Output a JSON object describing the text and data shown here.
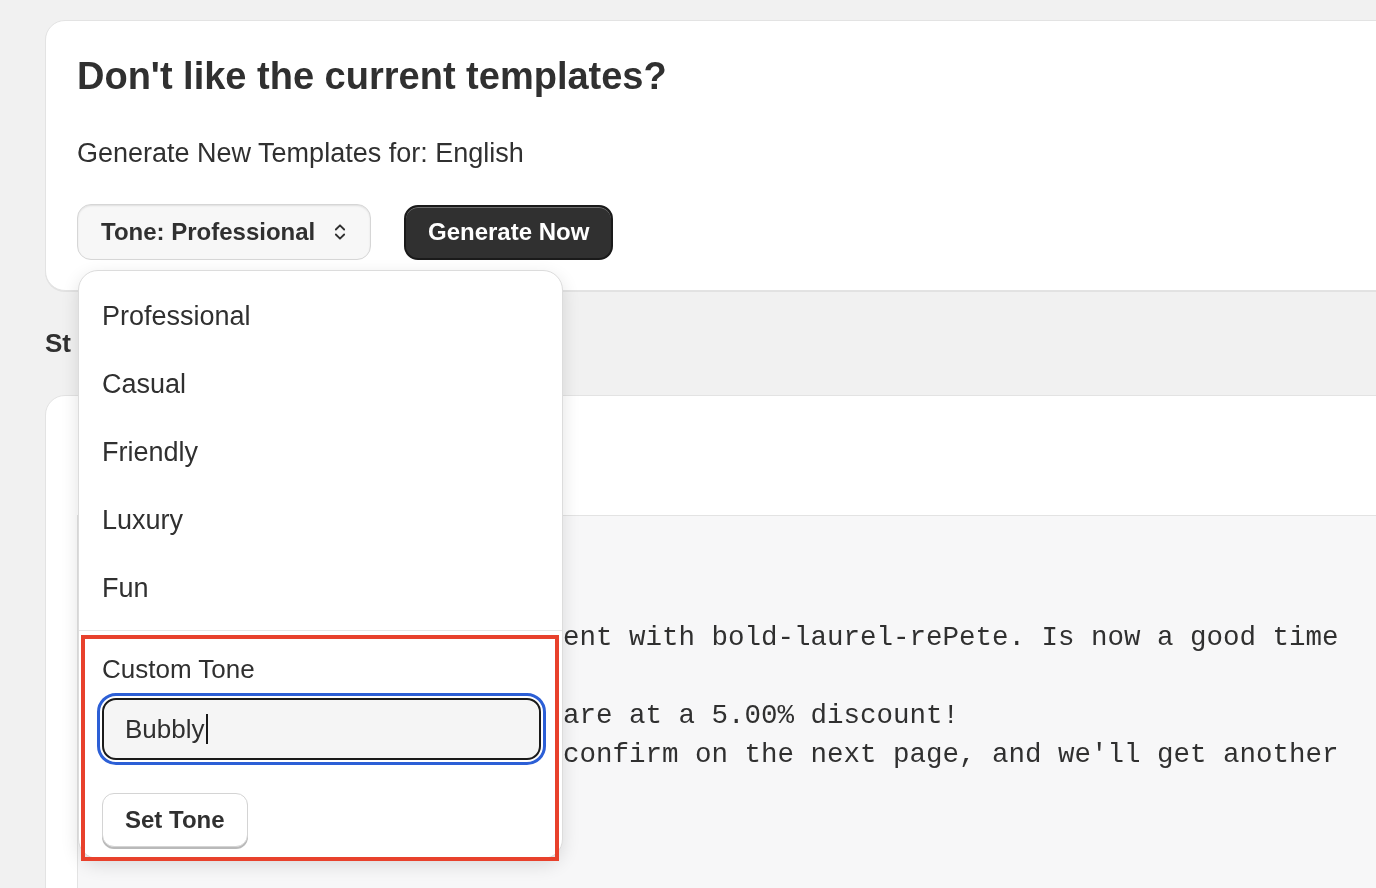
{
  "tone_card": {
    "title": "Don't like the current templates?",
    "subtitle": "Generate New Templates for: English",
    "tone_select": {
      "label": "Tone: Professional",
      "expanded": true
    },
    "generate_button": "Generate Now"
  },
  "section_heading": "St",
  "tone_menu": {
    "options": [
      "Professional",
      "Casual",
      "Friendly",
      "Luxury",
      "Fun"
    ],
    "custom_tone": {
      "label": "Custom Tone",
      "input": {
        "value": "Bubbly",
        "focused": true
      },
      "button": "Set Tone"
    }
  },
  "preview": {
    "paragraphs": [
      [
        "ent with bold-laurel-rePete. Is now a good time"
      ],
      [
        "are at a 5.00% discount!",
        "confirm on the next page, and we'll get another"
      ]
    ]
  }
}
